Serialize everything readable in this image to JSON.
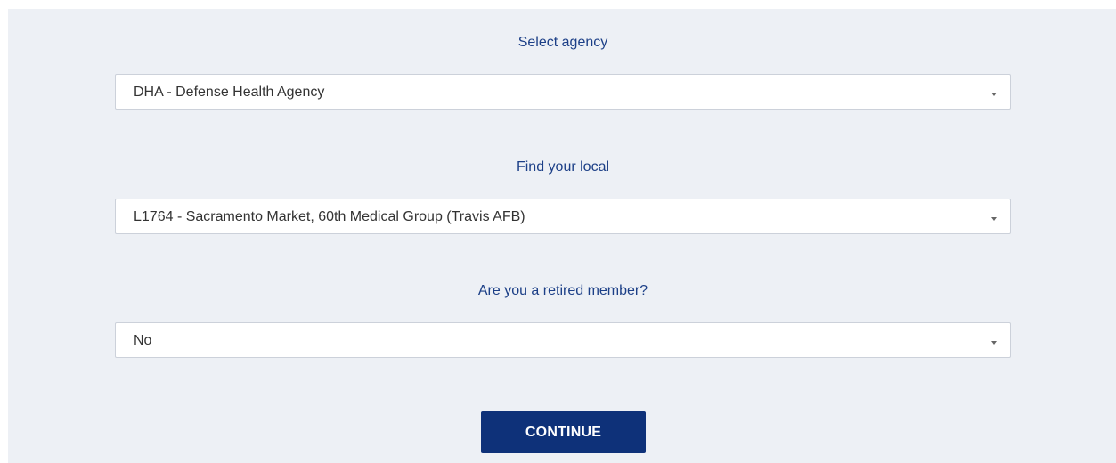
{
  "agency": {
    "label": "Select agency",
    "selected": "DHA - Defense Health Agency"
  },
  "local": {
    "label": "Find your local",
    "selected": "L1764 - Sacramento Market, 60th Medical Group (Travis AFB)"
  },
  "retired": {
    "label": "Are you a retired member?",
    "selected": "No"
  },
  "actions": {
    "continue_label": "CONTINUE"
  },
  "colors": {
    "panel_background": "#edf0f5",
    "label_text": "#1c3f87",
    "button_background": "#0e3179",
    "button_text": "#ffffff"
  }
}
